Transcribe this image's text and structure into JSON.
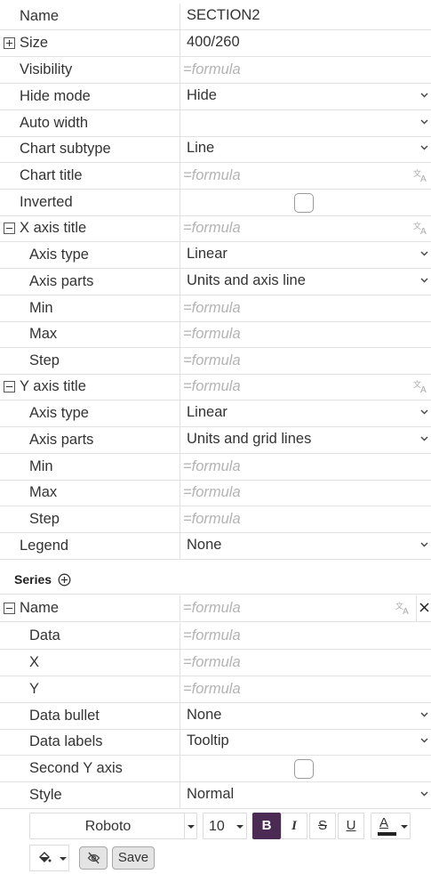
{
  "properties": {
    "name": {
      "label": "Name",
      "value": "SECTION2"
    },
    "size": {
      "label": "Size",
      "value": "400/260"
    },
    "visibility": {
      "label": "Visibility",
      "placeholder": "=formula"
    },
    "hide_mode": {
      "label": "Hide mode",
      "value": "Hide"
    },
    "auto_width": {
      "label": "Auto width",
      "value": ""
    },
    "chart_subtype": {
      "label": "Chart subtype",
      "value": "Line"
    },
    "chart_title": {
      "label": "Chart title",
      "placeholder": "=formula"
    },
    "inverted": {
      "label": "Inverted",
      "checked": false
    }
  },
  "x_axis": {
    "title": {
      "label": "X axis title",
      "placeholder": "=formula"
    },
    "axis_type": {
      "label": "Axis type",
      "value": "Linear"
    },
    "axis_parts": {
      "label": "Axis parts",
      "value": "Units and axis line"
    },
    "min": {
      "label": "Min",
      "placeholder": "=formula"
    },
    "max": {
      "label": "Max",
      "placeholder": "=formula"
    },
    "step": {
      "label": "Step",
      "placeholder": "=formula"
    }
  },
  "y_axis": {
    "title": {
      "label": "Y axis title",
      "placeholder": "=formula"
    },
    "axis_type": {
      "label": "Axis type",
      "value": "Linear"
    },
    "axis_parts": {
      "label": "Axis parts",
      "value": "Units and grid lines"
    },
    "min": {
      "label": "Min",
      "placeholder": "=formula"
    },
    "max": {
      "label": "Max",
      "placeholder": "=formula"
    },
    "step": {
      "label": "Step",
      "placeholder": "=formula"
    }
  },
  "legend": {
    "label": "Legend",
    "value": "None"
  },
  "series": {
    "title": "Series",
    "name": {
      "label": "Name",
      "placeholder": "=formula"
    },
    "data": {
      "label": "Data",
      "placeholder": "=formula"
    },
    "x": {
      "label": "X",
      "placeholder": "=formula"
    },
    "y": {
      "label": "Y",
      "placeholder": "=formula"
    },
    "data_bullet": {
      "label": "Data bullet",
      "value": "None"
    },
    "data_labels": {
      "label": "Data labels",
      "value": "Tooltip"
    },
    "second_y_axis": {
      "label": "Second Y axis",
      "checked": false
    },
    "style": {
      "label": "Style",
      "value": "Normal"
    }
  },
  "toolbar": {
    "font": "Roboto",
    "font_size": "10",
    "bold_label": "B",
    "italic_label": "I",
    "strike_label": "S",
    "underline_label": "U",
    "text_color_label": "A",
    "text_color": "#222222",
    "bold_active_color": "#4b2b54",
    "save_label": "Save"
  },
  "icons": {
    "expand": "plus-square-icon",
    "collapse": "minus-square-icon",
    "dropdown": "chevron-down-icon",
    "translate": "translate-icon",
    "add": "plus-circle-icon",
    "delete": "close-icon",
    "fill": "paint-bucket-icon",
    "hide": "eye-off-icon"
  }
}
